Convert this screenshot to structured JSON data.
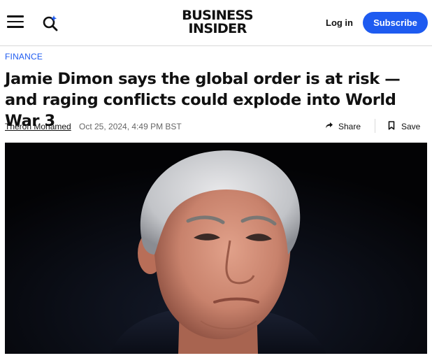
{
  "header": {
    "logo_line1": "BUSINESS",
    "logo_line2": "INSIDER",
    "menu_icon": "hamburger-menu-icon",
    "search_icon": "search-icon",
    "login_label": "Log in",
    "subscribe_label": "Subscribe",
    "accent_color": "#1e5bf0"
  },
  "article": {
    "category": "FINANCE",
    "headline": "Jamie Dimon says the global order is at risk — and raging conflicts could explode into World War 3",
    "author": "Theron Mohamed",
    "timestamp": "Oct 25, 2024, 4:49 PM BST",
    "share_label": "Share",
    "save_label": "Save",
    "share_icon": "share-arrow-icon",
    "save_icon": "bookmark-icon"
  }
}
